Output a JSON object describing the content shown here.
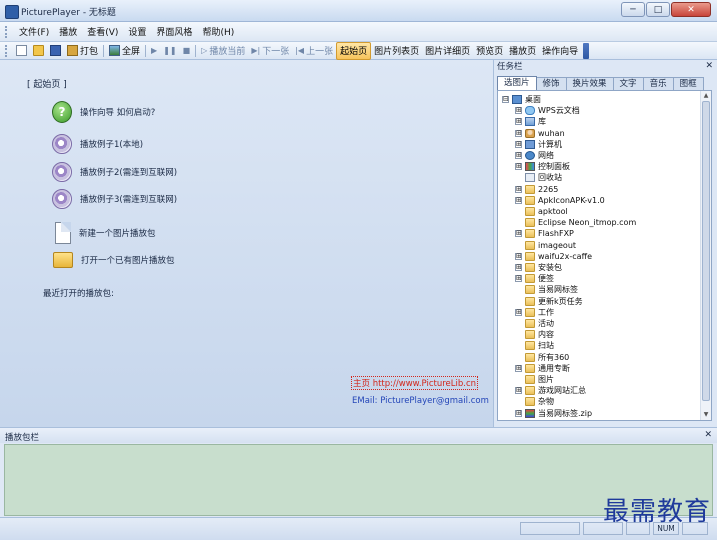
{
  "window": {
    "title": "PicturePlayer - 无标题",
    "min": "─",
    "max": "□",
    "close": "✕"
  },
  "menu": [
    "文件(F)",
    "播放",
    "查看(V)",
    "设置",
    "界面风格",
    "帮助(H)"
  ],
  "toolbar": {
    "package": "打包",
    "fullscreen": "全屏",
    "play_current": "播放当前",
    "next": "下一张",
    "prev": "上一张",
    "start_page": "起始页",
    "list_page": "图片列表页",
    "detail_page": "图片详细页",
    "preview_page": "预览页",
    "play_page": "播放页",
    "wizard": "操作向导"
  },
  "main": {
    "start_title": "[ 起始页 ]",
    "items": [
      {
        "label": "操作向导  如何启动?",
        "icon": "wizard-icon"
      },
      {
        "label": "播放例子1(本地)",
        "icon": "disc-icon"
      },
      {
        "label": "播放例子2(需连到互联网)",
        "icon": "disc-icon"
      },
      {
        "label": "播放例子3(需连到互联网)",
        "icon": "disc-icon"
      },
      {
        "label": "新建一个图片播放包",
        "icon": "new-document-icon"
      },
      {
        "label": "打开一个已有图片播放包",
        "icon": "open-folder-icon"
      }
    ],
    "recent_label": "最近打开的播放包:",
    "homepage": "主页 http://www.PictureLib.cn",
    "email": "EMail: PicturePlayer@gmail.com"
  },
  "taskpane": {
    "title": "任务栏",
    "close": "✕",
    "tabs": [
      "选图片",
      "修饰",
      "换片效果",
      "文字",
      "音乐",
      "图框"
    ],
    "tree": [
      {
        "label": "桌面",
        "expander": "⊟",
        "icon": "desktop"
      },
      {
        "label": "WPS云文档",
        "expander": "⊞",
        "icon": "cloud"
      },
      {
        "label": "库",
        "expander": "⊞",
        "icon": "lib"
      },
      {
        "label": "wuhan",
        "expander": "⊞",
        "icon": "user"
      },
      {
        "label": "计算机",
        "expander": "⊞",
        "icon": "computer"
      },
      {
        "label": "网络",
        "expander": "⊞",
        "icon": "network"
      },
      {
        "label": "控制面板",
        "expander": "⊞",
        "icon": "control"
      },
      {
        "label": "回收站",
        "expander": "",
        "icon": "recycle"
      },
      {
        "label": "2265",
        "expander": "⊞",
        "icon": "folder"
      },
      {
        "label": "ApkIconAPK-v1.0",
        "expander": "⊞",
        "icon": "folder"
      },
      {
        "label": "apktool",
        "expander": "",
        "icon": "folder"
      },
      {
        "label": "Eclipse Neon_itmop.com",
        "expander": "",
        "icon": "folder"
      },
      {
        "label": "FlashFXP",
        "expander": "⊞",
        "icon": "folder"
      },
      {
        "label": "imageout",
        "expander": "",
        "icon": "folder"
      },
      {
        "label": "waifu2x-caffe",
        "expander": "⊞",
        "icon": "folder"
      },
      {
        "label": "安装包",
        "expander": "⊞",
        "icon": "folder"
      },
      {
        "label": "便签",
        "expander": "⊞",
        "icon": "folder"
      },
      {
        "label": "当易网标签",
        "expander": "",
        "icon": "folder"
      },
      {
        "label": "更新k页任务",
        "expander": "",
        "icon": "folder"
      },
      {
        "label": "工作",
        "expander": "⊞",
        "icon": "folder"
      },
      {
        "label": "活动",
        "expander": "",
        "icon": "folder"
      },
      {
        "label": "内容",
        "expander": "",
        "icon": "folder"
      },
      {
        "label": "扫站",
        "expander": "",
        "icon": "folder"
      },
      {
        "label": "所有360",
        "expander": "",
        "icon": "folder"
      },
      {
        "label": "通用专断",
        "expander": "⊞",
        "icon": "folder"
      },
      {
        "label": "图片",
        "expander": "",
        "icon": "folder"
      },
      {
        "label": "游戏网站汇总",
        "expander": "⊞",
        "icon": "folder"
      },
      {
        "label": "杂物",
        "expander": "",
        "icon": "folder"
      },
      {
        "label": "当易网标签.zip",
        "expander": "⊞",
        "icon": "zip"
      }
    ]
  },
  "bottom": {
    "title": "播放包栏",
    "close": "✕"
  },
  "status": {
    "num": "NUM"
  },
  "watermark": "最需教育"
}
